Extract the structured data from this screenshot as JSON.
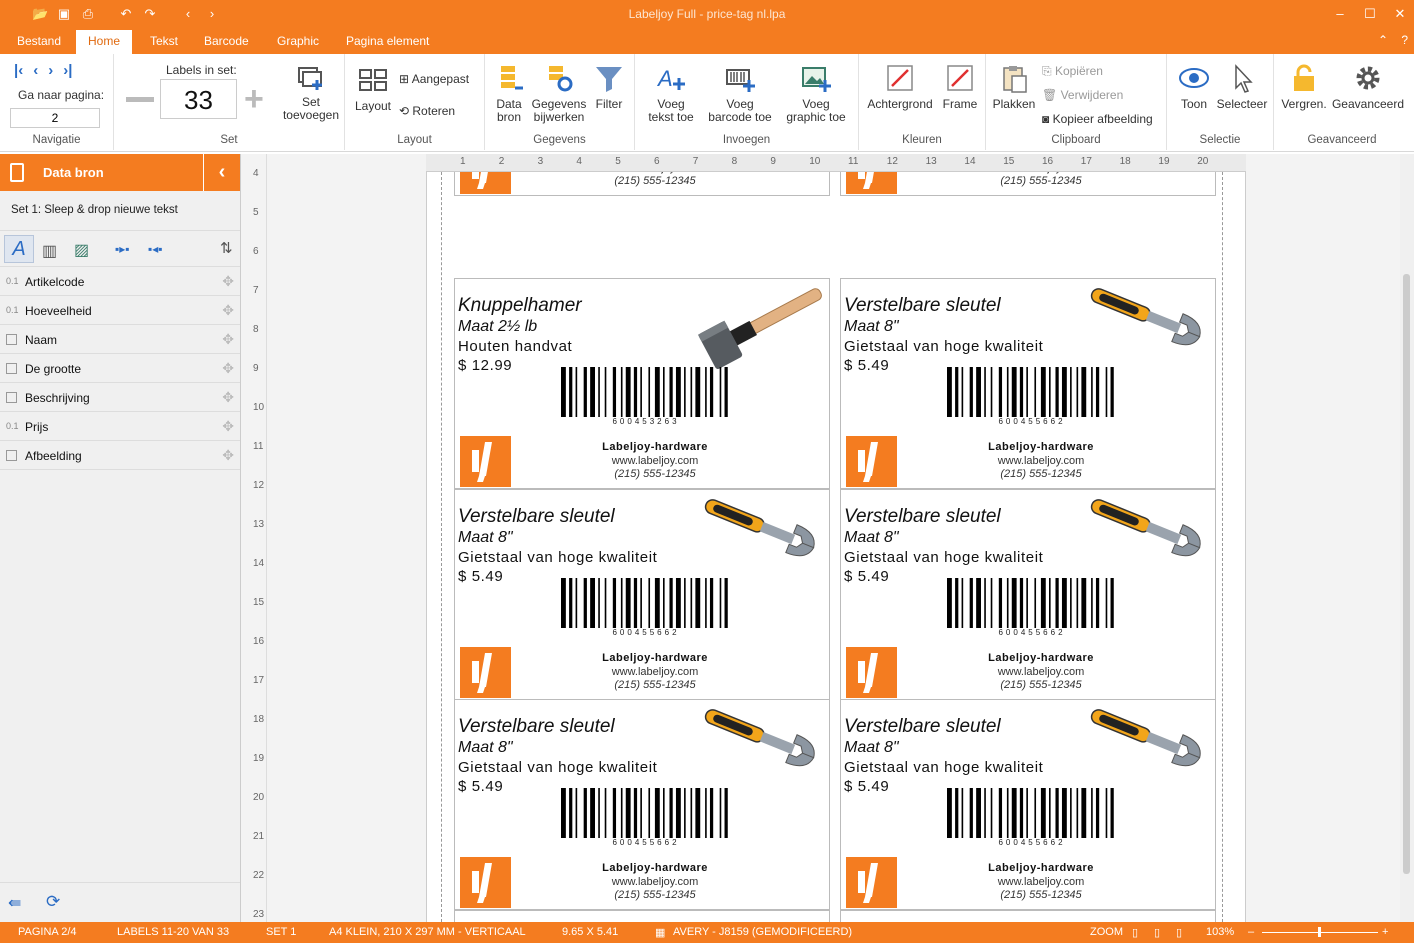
{
  "app": {
    "title": "Labeljoy Full - price-tag nl.lpa"
  },
  "menu_tabs": [
    "Bestand",
    "Home",
    "Tekst",
    "Barcode",
    "Graphic",
    "Pagina element"
  ],
  "ribbon": {
    "navigatie": {
      "goto_label": "Ga naar pagina:",
      "page_value": "2",
      "group": "Navigatie"
    },
    "set": {
      "labels_in_set_label": "Labels in set:",
      "labels_in_set_value": "33",
      "set_toevoegen": "Set\ntoevoegen",
      "group": "Set"
    },
    "layout": {
      "layout": "Layout",
      "aangepast": "Aangepast",
      "roteren": "Roteren",
      "group": "Layout"
    },
    "gegevens": {
      "data_bron": "Data\nbron",
      "gegevens_bijwerken": "Gegevens\nbijwerken",
      "filter": "Filter",
      "group": "Gegevens"
    },
    "invoegen": {
      "voeg_tekst": "Voeg\ntekst toe",
      "voeg_barcode": "Voeg\nbarcode toe",
      "voeg_graphic": "Voeg\ngraphic toe",
      "group": "Invoegen"
    },
    "kleuren": {
      "achtergrond": "Achtergrond",
      "frame": "Frame",
      "group": "Kleuren"
    },
    "clipboard": {
      "plakken": "Plakken",
      "kopieren": "Kopiëren",
      "verwijderen": "Verwijderen",
      "kopieer_afbeelding": "Kopieer afbeelding",
      "group": "Clipboard"
    },
    "selectie": {
      "toon": "Toon",
      "selecteer": "Selecteer",
      "group": "Selectie"
    },
    "geavanceerd": {
      "vergrendelen": "Vergren.",
      "geavanceerd": "Geavanceerd",
      "group": "Geavanceerd"
    }
  },
  "sidebar": {
    "title": "Data bron",
    "set_line": "Set 1: Sleep & drop nieuwe tekst",
    "fields": [
      {
        "type": "0.1",
        "name": "Artikelcode"
      },
      {
        "type": "",
        "name": "Hoeveelheid",
        "type2": "0.1"
      },
      {
        "type": "",
        "name": "Naam"
      },
      {
        "type": "",
        "name": "De grootte"
      },
      {
        "type": "",
        "name": "Beschrijving"
      },
      {
        "type": "0.1",
        "name": "Prijs"
      },
      {
        "type": "",
        "name": "Afbeelding"
      }
    ]
  },
  "ruler": {
    "h": [
      "1",
      "2",
      "3",
      "4",
      "5",
      "6",
      "7",
      "8",
      "9",
      "10",
      "11",
      "12",
      "13",
      "14",
      "15",
      "16",
      "17",
      "18",
      "19",
      "20"
    ],
    "v": [
      "4",
      "5",
      "6",
      "7",
      "8",
      "9",
      "10",
      "11",
      "12",
      "13",
      "14",
      "15",
      "16",
      "17",
      "18",
      "19",
      "20",
      "21",
      "22",
      "23"
    ]
  },
  "labels": {
    "company": "Labeljoy-hardware",
    "web": "www.labeljoy.com",
    "phone": "(215) 555-12345",
    "barcode_1": "600453263",
    "barcode_2": "600455662",
    "hammer": {
      "name": "Knuppelhamer",
      "size": "Maat 2½ lb",
      "desc": "Houten handvat",
      "price": "$ 12.99"
    },
    "wrench": {
      "name": "Verstelbare sleutel",
      "size": "Maat 8\"",
      "desc": "Gietstaal van hoge kwaliteit",
      "price": "$ 5.49"
    }
  },
  "status": {
    "page": "PAGINA 2/4",
    "labels": "LABELS 11-20 VAN 33",
    "set": "SET 1",
    "paper": "A4 KLEIN, 210 X 297 MM - VERTICAAL",
    "dims": "9.65 X 5.41",
    "template": "AVERY - J8159 (GEMODIFICEERD)",
    "zoom_label": "ZOOM",
    "zoom_value": "103%"
  },
  "colors": {
    "accent": "#f47c20"
  }
}
